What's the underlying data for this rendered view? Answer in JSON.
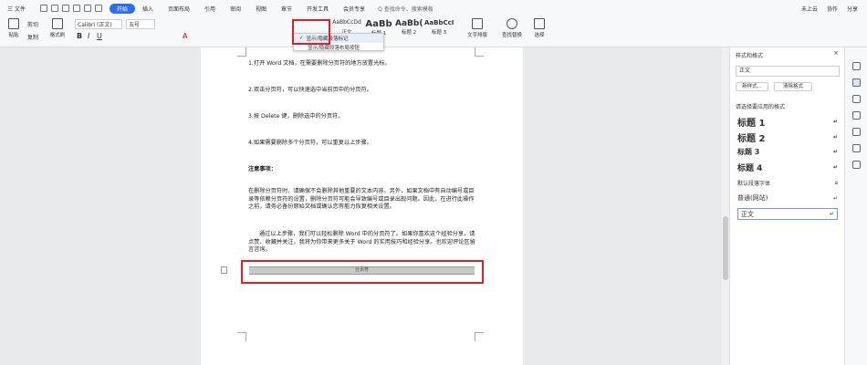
{
  "menubar": {
    "file": "三 文件",
    "tabs": [
      "开始",
      "插入",
      "页面布局",
      "引用",
      "审阅",
      "视图",
      "章节",
      "开发工具",
      "会员专享"
    ],
    "active_tab": "开始",
    "search": "Q 查找命令、搜索模板",
    "right": [
      "未上云",
      "协作",
      "分享"
    ]
  },
  "ribbon": {
    "paste": "粘贴",
    "cut": "剪切",
    "copy": "复制",
    "format_painter": "格式刷",
    "font_name": "Calibri (正文)",
    "font_size": "五号",
    "style_previews": [
      "AaBbCcDd",
      "AaBb",
      "AaBb(",
      "AaBbCcI"
    ],
    "style_labels": [
      "正文",
      "标题 1",
      "标题 2",
      "标题 3"
    ],
    "text_layout": "文字排版",
    "find_replace": "查找替换",
    "select": "选择"
  },
  "dropdown": {
    "options": [
      "显示/隐藏段落标记",
      "显示/隐藏段落布局按钮"
    ]
  },
  "document": {
    "lines": [
      "1.打开 Word 文档，在需要删除分页符的地方放置光标。",
      "2.双击分页符，可以快速选中当前页中的分页符。",
      "3.按 Delete 键，删除选中的分页符。",
      "4.如果需要删除多个分页符，可以重复以上步骤。"
    ],
    "heading": "注意事项：",
    "para1": "在删除分页符时，请确保不会删除其他重要的文本内容。另外，如果文档中有自动编号或目录等依赖分页符的设置，删除分页符可能会导致编号或目录出现问题。因此，在进行此操作之前，请务必备份原始文档或确认您有能力恢复相关设置。",
    "para2": "通过以上步骤，我们可以轻松删除 Word 中的分页符了。如果你喜欢这个经验分享，请点赞、收藏并关注，我将为你带来更多关于 Word 的实用技巧和经验分享。也欢迎评论区留言咨询。",
    "page_break": "分页符"
  },
  "panel": {
    "title": "样式和格式",
    "current": "正文",
    "new_style": "新样式...",
    "clear_format": "清除格式",
    "apply_label": "请选择要应用的格式",
    "styles": [
      "标题 1",
      "标题 2",
      "标题 3",
      "标题 4",
      "默认段落字体",
      "普通(网站)",
      "正文"
    ]
  }
}
